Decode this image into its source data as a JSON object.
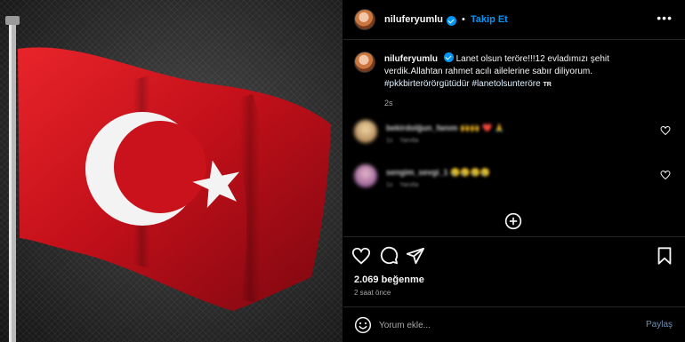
{
  "post": {
    "username": "niluferyumlu",
    "follow_label": "Takip Et",
    "header_separator": "•",
    "more_label": "•••",
    "caption_text": "Lanet olsun teröre!!!12 evladımızı şehit verdik.Allahtan rahmet acılı ailelerine sabır diliyorum.",
    "caption_hashtags": "#pkkbirterörörgütüdür #lanetolsunteröre",
    "caption_flag": "TR",
    "caption_age": "2s",
    "likes": "2.069 beğenme",
    "posted_ago": "2 saat önce",
    "comment_placeholder": "Yorum ekle...",
    "post_button": "Paylaş"
  },
  "comments": [
    {
      "user": "bekirdolğun_fanım",
      "text": "🙌🙌 ❤️ 🙏",
      "age": "1s",
      "reply": "Yanıtla"
    },
    {
      "user": "sengim_sevgi_1",
      "text": "😢😢😢😢",
      "age": "1s",
      "reply": "Yanıtla"
    }
  ],
  "icons": {
    "like": "heart-icon",
    "comment": "comment-icon",
    "share": "share-icon",
    "save": "bookmark-icon",
    "emoji": "emoji-icon",
    "load_more": "plus-circle-icon"
  },
  "colors": {
    "background": "#000000",
    "link_blue": "#0095f6",
    "flag_red": "#d1141c",
    "muted_text": "#a8a8a8"
  }
}
